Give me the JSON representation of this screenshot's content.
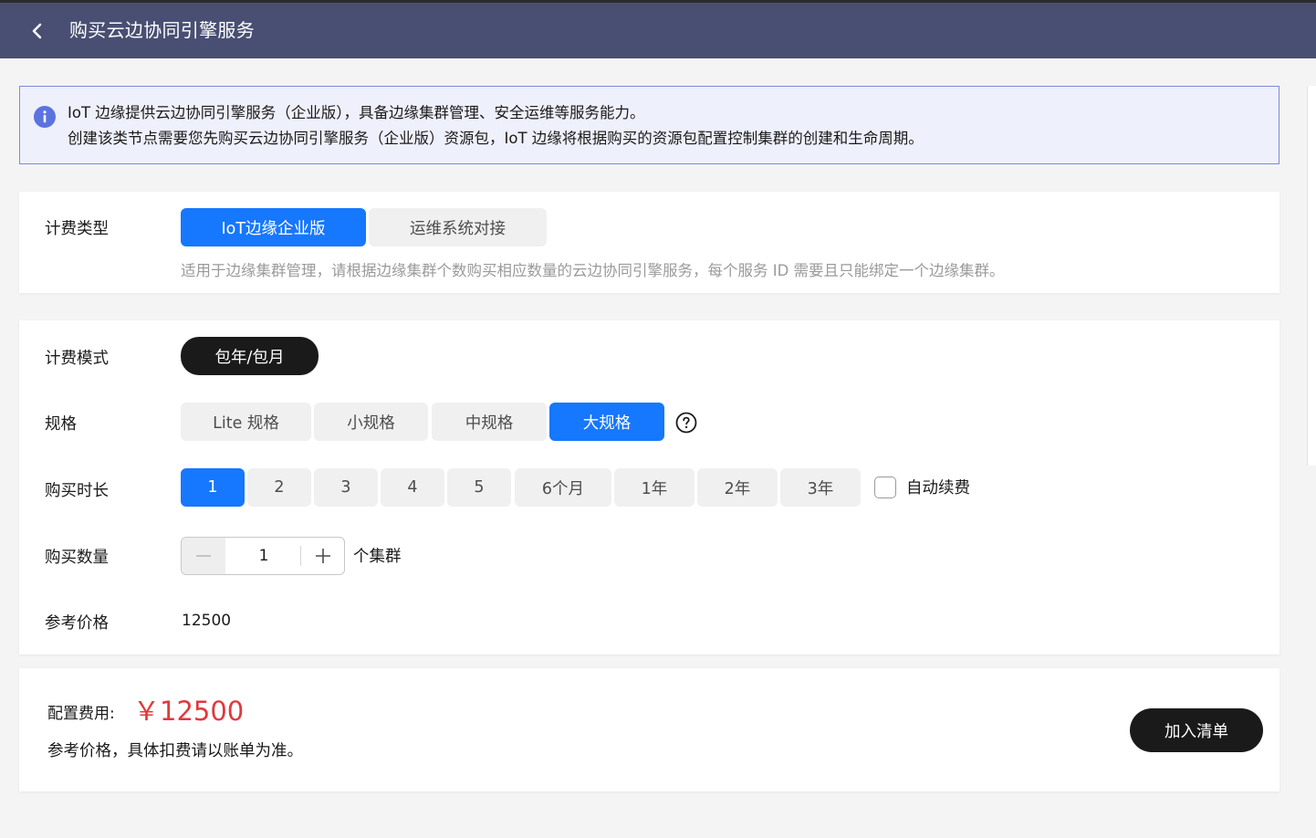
{
  "header": {
    "title": "购买云边协同引擎服务"
  },
  "notice": {
    "line1": "IoT 边缘提供云边协同引擎服务（企业版），具备边缘集群管理、安全运维等服务能力。",
    "line2": "创建该类节点需要您先购买云边协同引擎服务（企业版）资源包，IoT 边缘将根据购买的资源包配置控制集群的创建和生命周期。"
  },
  "billing_type": {
    "label": "计费类型",
    "options": [
      "IoT边缘企业版",
      "运维系统对接"
    ],
    "selected": "IoT边缘企业版",
    "hint": "适用于边缘集群管理，请根据边缘集群个数购买相应数量的云边协同引擎服务，每个服务 ID 需要且只能绑定一个边缘集群。"
  },
  "billing_mode": {
    "label": "计费模式",
    "options": [
      "包年/包月"
    ],
    "selected": "包年/包月"
  },
  "spec": {
    "label": "规格",
    "options": [
      "Lite 规格",
      "小规格",
      "中规格",
      "大规格"
    ],
    "selected": "大规格"
  },
  "duration": {
    "label": "购买时长",
    "options": [
      "1",
      "2",
      "3",
      "4",
      "5",
      "6个月",
      "1年",
      "2年",
      "3年"
    ],
    "selected": "1",
    "auto_renew_label": "自动续费",
    "auto_renew_checked": false
  },
  "quantity": {
    "label": "购买数量",
    "value": "1",
    "unit": "个集群"
  },
  "reference_price": {
    "label": "参考价格",
    "value": "12500"
  },
  "summary": {
    "fee_label": "配置费用:",
    "fee_value": "￥12500",
    "note": "参考价格，具体扣费请以账单为准。",
    "add_button": "加入清单"
  },
  "colors": {
    "header_bg": "#494f72",
    "accent": "#1677ff",
    "price": "#e0393e",
    "dark_button": "#1a1a1a"
  }
}
